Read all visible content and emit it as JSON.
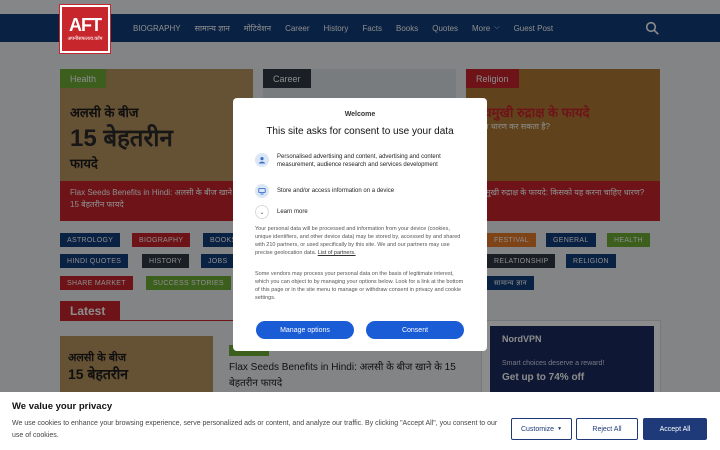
{
  "logo": {
    "mark": "AFT",
    "tagline": "अपनीसफलता.कॉम"
  },
  "nav": {
    "items": [
      "BIOGRAPHY",
      "सामान्य ज्ञान",
      "मोटिवेशन",
      "Career",
      "History",
      "Facts",
      "Books",
      "Quotes",
      "More",
      "Guest Post"
    ],
    "more_index": 8
  },
  "cards": [
    {
      "tag": "Health",
      "image_text_1": "अलसी के बीज",
      "image_text_2": "15 बेहतरीन",
      "image_text_3": "फायदे",
      "caption": "Flax Seeds Benefits in Hindi: अलसी के बीज खाने के 15 बेहतरीन फायदे"
    },
    {
      "tag": "Career",
      "caption": ""
    },
    {
      "tag": "Religion",
      "image_text_1": "पंचमुखी रुद्राक्ष के फायदे",
      "image_sub": "कौन धारण कर सकता है?",
      "caption": "पंचमुखी रुद्राक्ष के फायदे: किसको यह करना चाहिए धारण?"
    }
  ],
  "categories": [
    {
      "label": "ASTROLOGY",
      "color": "#123c79"
    },
    {
      "label": "BIOGRAPHY",
      "color": "#c8262d"
    },
    {
      "label": "BOOKS",
      "color": "#123c79"
    },
    {
      "label": "FESTIVAL",
      "color": "#e57c2d"
    },
    {
      "label": "GENERAL",
      "color": "#123c79"
    },
    {
      "label": "HEALTH",
      "color": "#6fae38"
    },
    {
      "label": "HINDI QUOTES",
      "color": "#123c79"
    },
    {
      "label": "HISTORY",
      "color": "#2e3a44"
    },
    {
      "label": "JOBS",
      "color": "#123c79"
    },
    {
      "label": "RELATIONSHIP",
      "color": "#2e3a44"
    },
    {
      "label": "RELIGION",
      "color": "#123c79"
    },
    {
      "label": "SHARE MARKET",
      "color": "#c8262d"
    },
    {
      "label": "SUCCESS STORIES",
      "color": "#6fae38"
    },
    {
      "label": "सामान्य ज्ञान",
      "color": "#123c79"
    }
  ],
  "latest": {
    "label": "Latest",
    "image_text_1": "अलसी के बीज",
    "image_text_2": "15 बेहतरीन",
    "title": "Flax Seeds Benefits in Hindi: अलसी के बीज खाने के 15 बेहतरीन फायदे"
  },
  "ad": {
    "brand": "NordVPN",
    "line1": "Smart choices deserve a reward!",
    "line2": "Get up to 74% off"
  },
  "consent": {
    "welcome": "Welcome",
    "title": "This site asks for consent to use your data",
    "purposes": [
      "Personalised advertising and content, advertising and content measurement, audience research and services development",
      "Store and/or access information on a device"
    ],
    "learn_more": "Learn more",
    "paragraph1": "Your personal data will be processed and information from your device (cookies, unique identifiers, and other device data) may be stored by, accessed by and shared with 210 partners, or used specifically by this site. We and our partners may use precise geolocation data.",
    "partners_link": "List of partners.",
    "paragraph2": "Some vendors may process your personal data on the basis of legitimate interest, which you can object to by managing your options below. Look for a link at the bottom of this page or in the site menu to manage or withdraw consent in privacy and cookie settings.",
    "manage_label": "Manage options",
    "consent_label": "Consent"
  },
  "privacy": {
    "title": "We value your privacy",
    "text": "We use cookies to enhance your browsing experience, serve personalized ads or content, and analyze our traffic. By clicking \"Accept All\", you consent to our use of cookies.",
    "customize_label": "Customize",
    "reject_label": "Reject All",
    "accept_label": "Accept All"
  }
}
